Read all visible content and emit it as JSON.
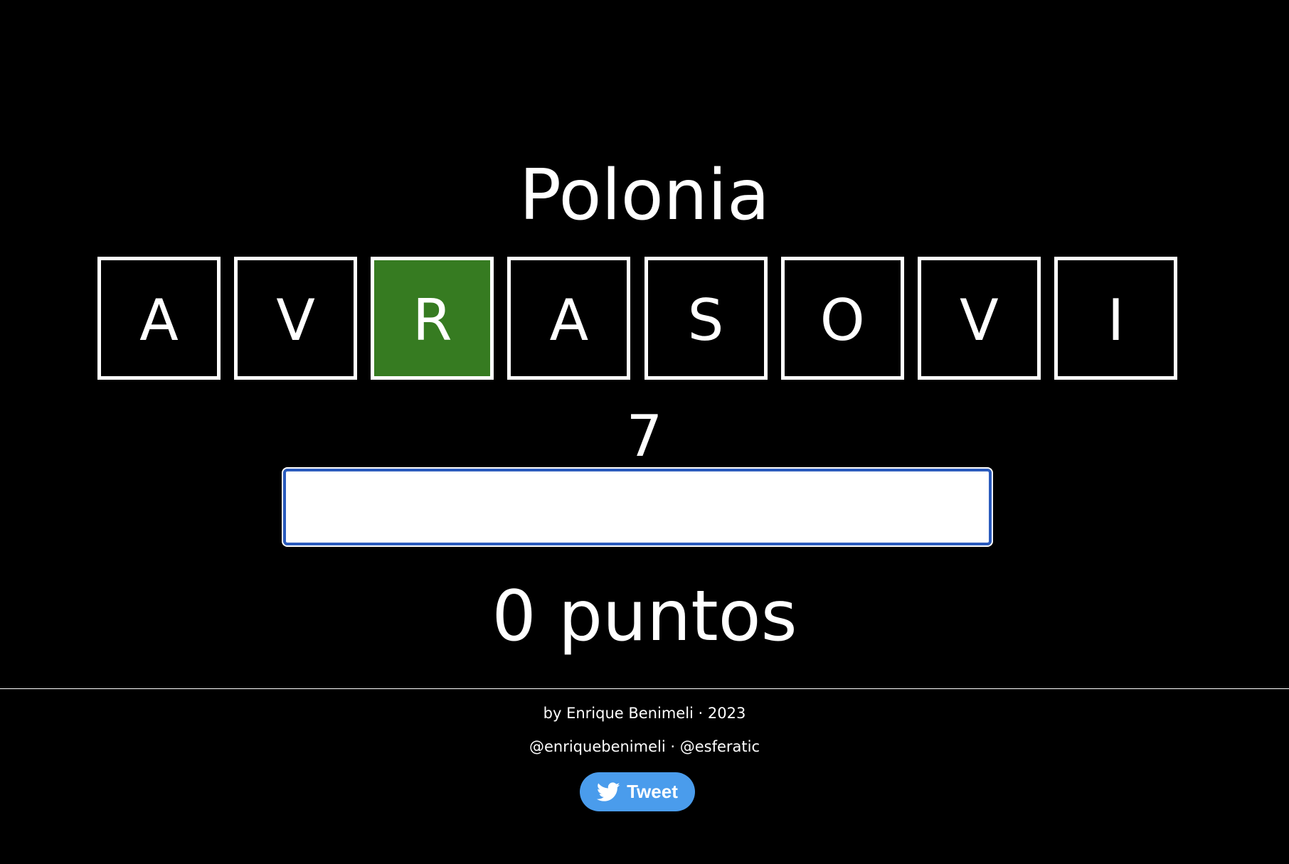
{
  "game": {
    "title": "Polonia",
    "tiles": [
      {
        "letter": "A",
        "state": "empty"
      },
      {
        "letter": "V",
        "state": "empty"
      },
      {
        "letter": "R",
        "state": "correct"
      },
      {
        "letter": "A",
        "state": "empty"
      },
      {
        "letter": "S",
        "state": "empty"
      },
      {
        "letter": "O",
        "state": "empty"
      },
      {
        "letter": "V",
        "state": "empty"
      },
      {
        "letter": "I",
        "state": "empty"
      }
    ],
    "counter": "7",
    "input": {
      "value": "",
      "placeholder": ""
    },
    "score": "0 puntos"
  },
  "footer": {
    "credit": "by Enrique Benimeli · 2023",
    "handles": "@enriquebenimeli · @esferatic",
    "tweet_label": "Tweet",
    "tweet_icon": "twitter-bird-icon"
  },
  "colors": {
    "background": "#000000",
    "tile_border": "#ffffff",
    "tile_correct": "#367b21",
    "input_border": "#2a5bbd",
    "tweet_button": "#4a9cec"
  }
}
